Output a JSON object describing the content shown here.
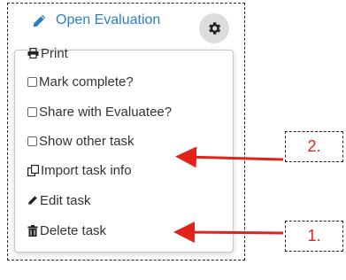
{
  "header": {
    "open_evaluation_label": "Open Evaluation",
    "icons": {
      "pencil": "pencil-icon",
      "settings": "gear-icon"
    },
    "link_color": "#2980c4"
  },
  "menu": {
    "items": [
      {
        "label": "Print",
        "icon": "printer-icon"
      },
      {
        "label": "Mark complete?",
        "icon": "checkbox-icon"
      },
      {
        "label": "Share with Evaluatee?",
        "icon": "checkbox-icon"
      },
      {
        "label": "Show other task",
        "icon": "checkbox-icon"
      },
      {
        "label": "Import task info",
        "icon": "copy-icon"
      },
      {
        "label": "Edit task",
        "icon": "pencil-icon"
      },
      {
        "label": "Delete task",
        "icon": "trash-icon"
      }
    ]
  },
  "annotations": {
    "callouts": [
      {
        "label": "2.",
        "points_to": "Show other task"
      },
      {
        "label": "1.",
        "points_to": "Edit task"
      }
    ],
    "arrow_color": "#e2231a"
  }
}
